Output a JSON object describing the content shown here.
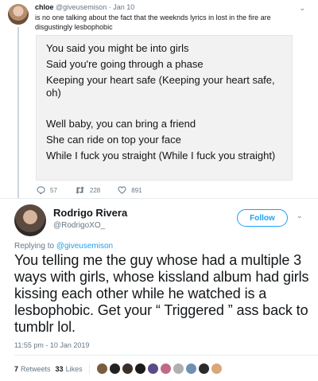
{
  "quoted_tweet": {
    "name": "chloe",
    "handle_time": "@giveusemison · Jan 10",
    "text": "is no one talking about the fact that the weeknds lyrics in lost in the fire are disgustingly lesbophobic",
    "lyrics": [
      "You said you might be into girls",
      "Said you're going through a phase",
      "Keeping your heart safe (Keeping your heart safe, oh)",
      "Well baby, you can bring a friend",
      "She can ride on top your face",
      "While I fuck you straight (While I fuck you straight)"
    ],
    "actions": {
      "replies": "57",
      "retweets": "228",
      "likes": "891"
    }
  },
  "main_tweet": {
    "name": "Rodrigo Rivera",
    "handle": "@RodrigoXO_",
    "follow_label": "Follow",
    "replying_prefix": "Replying to",
    "replying_to": "@giveusemison",
    "text": "You telling me the guy whose had a multiple 3 ways with girls, whose kissland album had girls kissing each other while he watched is a lesbophobic. Get your “ Triggered ” ass back to tumblr lol.",
    "timestamp": "11:55 pm - 10 Jan 2019",
    "retweets_count": "7",
    "retweets_label": "Retweets",
    "likes_count": "33",
    "likes_label": "Likes"
  },
  "colors": {
    "accent": "#1da1f2",
    "muted": "#657786",
    "text": "#14171a"
  },
  "liker_avatar_colors": [
    "#7a5c3e",
    "#222222",
    "#3a2f2a",
    "#1a1a1a",
    "#5b4a8a",
    "#c06a8a",
    "#b0b0b0",
    "#6f8fb3",
    "#2b2b2b",
    "#d9a77a"
  ]
}
